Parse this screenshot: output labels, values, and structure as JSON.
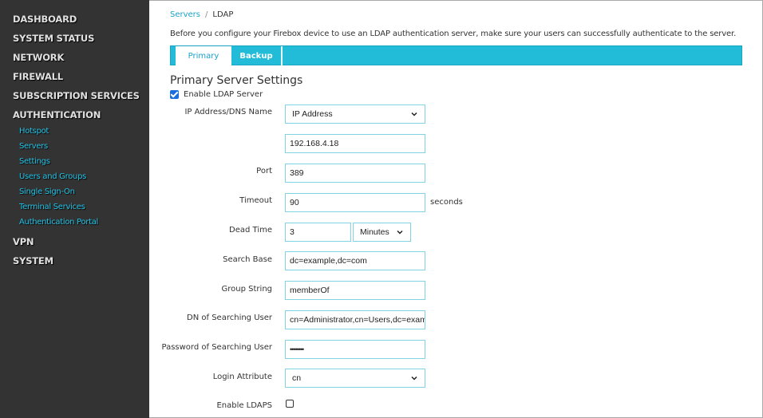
{
  "sidebar": {
    "top_items": [
      {
        "label": "DASHBOARD"
      },
      {
        "label": "SYSTEM STATUS"
      },
      {
        "label": "NETWORK"
      },
      {
        "label": "FIREWALL"
      },
      {
        "label": "SUBSCRIPTION SERVICES"
      },
      {
        "label": "AUTHENTICATION"
      },
      {
        "label": "VPN"
      },
      {
        "label": "SYSTEM"
      }
    ],
    "authentication_sub_items": [
      {
        "label": "Hotspot"
      },
      {
        "label": "Servers"
      },
      {
        "label": "Settings"
      },
      {
        "label": "Users and Groups"
      },
      {
        "label": "Single Sign-On"
      },
      {
        "label": "Terminal Services"
      },
      {
        "label": "Authentication Portal"
      }
    ]
  },
  "breadcrumb": {
    "parent": "Servers",
    "separator": "/",
    "current": "LDAP"
  },
  "intro_text": "Before you configure your Firebox device to use an LDAP authentication server, make sure your users can successfully authenticate to the server.",
  "tabs": [
    {
      "label": "Primary",
      "active": true
    },
    {
      "label": "Backup",
      "active": false
    }
  ],
  "section_title": "Primary Server Settings",
  "enable_ldap": {
    "label": "Enable LDAP Server",
    "checked": true
  },
  "form": {
    "ip_dns": {
      "label": "IP Address/DNS Name",
      "selected": "IP Address",
      "value": "192.168.4.18"
    },
    "port": {
      "label": "Port",
      "value": "389"
    },
    "timeout": {
      "label": "Timeout",
      "value": "90",
      "suffix": "seconds"
    },
    "dead_time": {
      "label": "Dead Time",
      "value": "3",
      "unit": "Minutes"
    },
    "search_base": {
      "label": "Search Base",
      "value": "dc=example,dc=com"
    },
    "group_string": {
      "label": "Group String",
      "value": "memberOf"
    },
    "dn_searching_user": {
      "label": "DN of Searching User",
      "value": "cn=Administrator,cn=Users,dc=exampl"
    },
    "password_searching_user": {
      "label": "Password of Searching User",
      "value": "••••••••"
    },
    "login_attribute": {
      "label": "Login Attribute",
      "selected": "cn"
    },
    "enable_ldaps": {
      "label": "Enable LDAPS",
      "checked": false
    }
  },
  "colors": {
    "sidebar_bg": "#333333",
    "accent": "#22bcd8",
    "link": "#1aa3c6",
    "field_border": "#7fd3e3"
  }
}
